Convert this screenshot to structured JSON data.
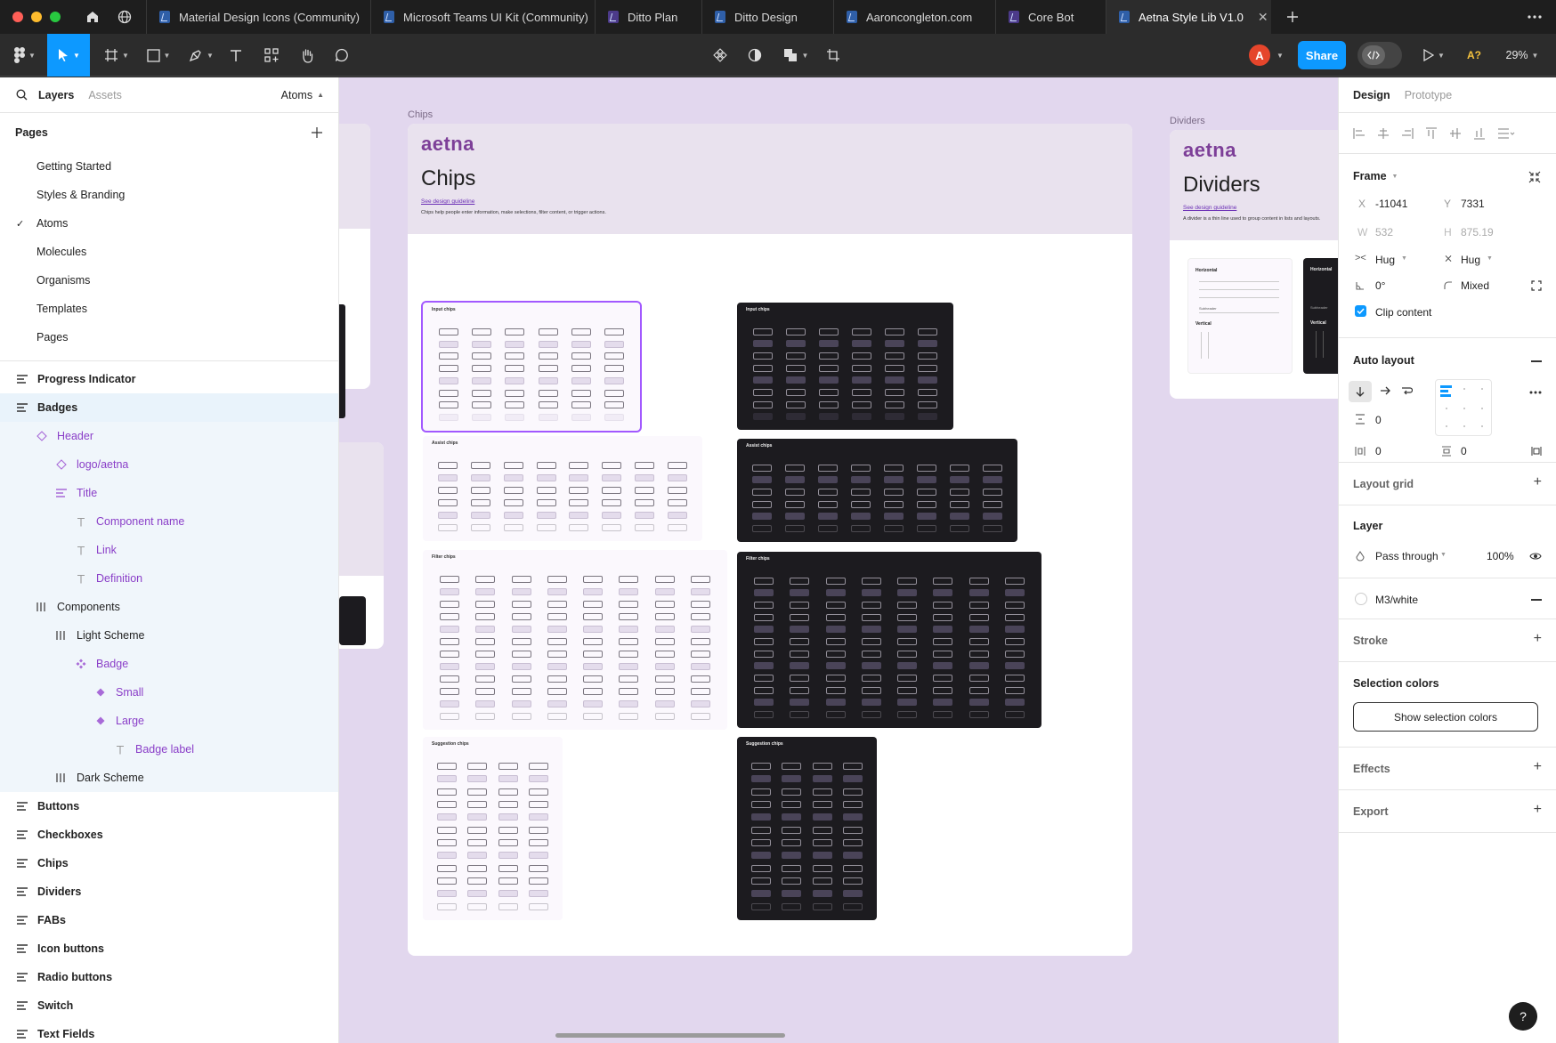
{
  "tabs": [
    {
      "label": "Material Design Icons (Community)",
      "icon": "figma-file-icon"
    },
    {
      "label": "Microsoft Teams UI Kit (Community)",
      "icon": "figma-file-icon"
    },
    {
      "label": "Ditto Plan",
      "icon": "figjam-file-icon"
    },
    {
      "label": "Ditto Design",
      "icon": "figma-file-icon"
    },
    {
      "label": "Aaroncongleton.com",
      "icon": "figma-file-icon"
    },
    {
      "label": "Core Bot",
      "icon": "figjam-file-icon"
    },
    {
      "label": "Aetna Style Lib V1.0",
      "icon": "figma-file-icon",
      "active": true
    }
  ],
  "toolbar": {
    "avatar_letter": "A",
    "share_label": "Share",
    "warning_label": "A?",
    "zoom": "29%"
  },
  "left_panel": {
    "layers_tab": "Layers",
    "assets_tab": "Assets",
    "current_page": "Atoms",
    "pages_heading": "Pages",
    "pages": [
      "Getting Started",
      "Styles & Branding",
      "Atoms",
      "Molecules",
      "Organisms",
      "Templates",
      "Pages"
    ],
    "layers": [
      {
        "label": "Progress Indicator",
        "indent": 0,
        "type": "frame",
        "kind": "top"
      },
      {
        "label": "Badges",
        "indent": 0,
        "type": "frame",
        "kind": "top-sel"
      },
      {
        "label": "Header",
        "indent": 1,
        "type": "instance",
        "kind": "child"
      },
      {
        "label": "logo/aetna",
        "indent": 2,
        "type": "instance",
        "kind": "child"
      },
      {
        "label": "Title",
        "indent": 2,
        "type": "frame",
        "kind": "child"
      },
      {
        "label": "Component name",
        "indent": 3,
        "type": "text",
        "kind": "child"
      },
      {
        "label": "Link",
        "indent": 3,
        "type": "text",
        "kind": "child"
      },
      {
        "label": "Definition",
        "indent": 3,
        "type": "text",
        "kind": "child"
      },
      {
        "label": "Components",
        "indent": 1,
        "type": "autolayout",
        "kind": "child-dk"
      },
      {
        "label": "Light Scheme",
        "indent": 2,
        "type": "autolayout",
        "kind": "child-dk"
      },
      {
        "label": "Badge",
        "indent": 3,
        "type": "component-set",
        "kind": "child"
      },
      {
        "label": "Small",
        "indent": 4,
        "type": "component",
        "kind": "child"
      },
      {
        "label": "Large",
        "indent": 4,
        "type": "component",
        "kind": "child"
      },
      {
        "label": "Badge label",
        "indent": 5,
        "type": "text",
        "kind": "child"
      },
      {
        "label": "Dark Scheme",
        "indent": 2,
        "type": "autolayout",
        "kind": "child-dk"
      },
      {
        "label": "Buttons",
        "indent": 0,
        "type": "frame",
        "kind": "top"
      },
      {
        "label": "Checkboxes",
        "indent": 0,
        "type": "frame",
        "kind": "top"
      },
      {
        "label": "Chips",
        "indent": 0,
        "type": "frame",
        "kind": "top"
      },
      {
        "label": "Dividers",
        "indent": 0,
        "type": "frame",
        "kind": "top"
      },
      {
        "label": "FABs",
        "indent": 0,
        "type": "frame",
        "kind": "top"
      },
      {
        "label": "Icon buttons",
        "indent": 0,
        "type": "frame",
        "kind": "top"
      },
      {
        "label": "Radio buttons",
        "indent": 0,
        "type": "frame",
        "kind": "top"
      },
      {
        "label": "Switch",
        "indent": 0,
        "type": "frame",
        "kind": "top"
      },
      {
        "label": "Text Fields",
        "indent": 0,
        "type": "frame",
        "kind": "top"
      }
    ]
  },
  "canvas": {
    "chips": {
      "frame_label": "Chips",
      "logo": "aetna",
      "title": "Chips",
      "link": "See design guideline",
      "definition": "Chips help people enter information, make selections, filter content, or trigger actions.",
      "sections": [
        {
          "name": "Input chips",
          "cols": 6,
          "rows": 8
        },
        {
          "name": "Assist chips",
          "cols": 8,
          "rows": 6
        },
        {
          "name": "Filter chips",
          "cols": 8,
          "rows": 12
        },
        {
          "name": "Suggestion chips",
          "cols": 4,
          "rows": 12
        }
      ]
    },
    "dividers": {
      "frame_label": "Dividers",
      "logo": "aetna",
      "title": "Dividers",
      "link": "See design guideline",
      "definition": "A divider is a thin line used to group content in lists and layouts.",
      "horizontal": "Horizontal",
      "vertical": "Vertical",
      "subheader": "Subheader"
    }
  },
  "right_panel": {
    "design_tab": "Design",
    "prototype_tab": "Prototype",
    "frame": {
      "title": "Frame",
      "x_label": "X",
      "x": "-11041",
      "y_label": "Y",
      "y": "7331",
      "w_label": "W",
      "w": "532",
      "h_label": "H",
      "h": "875.19",
      "width_mode": "Hug",
      "height_mode": "Hug",
      "rotation": "0°",
      "radius": "Mixed",
      "clip_label": "Clip content"
    },
    "auto_layout": {
      "title": "Auto layout",
      "gap": "0",
      "padding_h": "0",
      "padding_v": "0"
    },
    "layout_grid": "Layout grid",
    "layer": {
      "title": "Layer",
      "blend": "Pass through",
      "opacity": "100%"
    },
    "fill": {
      "name": "M3/white"
    },
    "stroke": "Stroke",
    "selection_colors": {
      "title": "Selection colors",
      "button": "Show selection colors"
    },
    "effects": "Effects",
    "export": "Export"
  },
  "help": "?",
  "colors": {
    "accent": "#0d99ff",
    "selection": "#a259ff",
    "brand": "#7d3f98"
  }
}
